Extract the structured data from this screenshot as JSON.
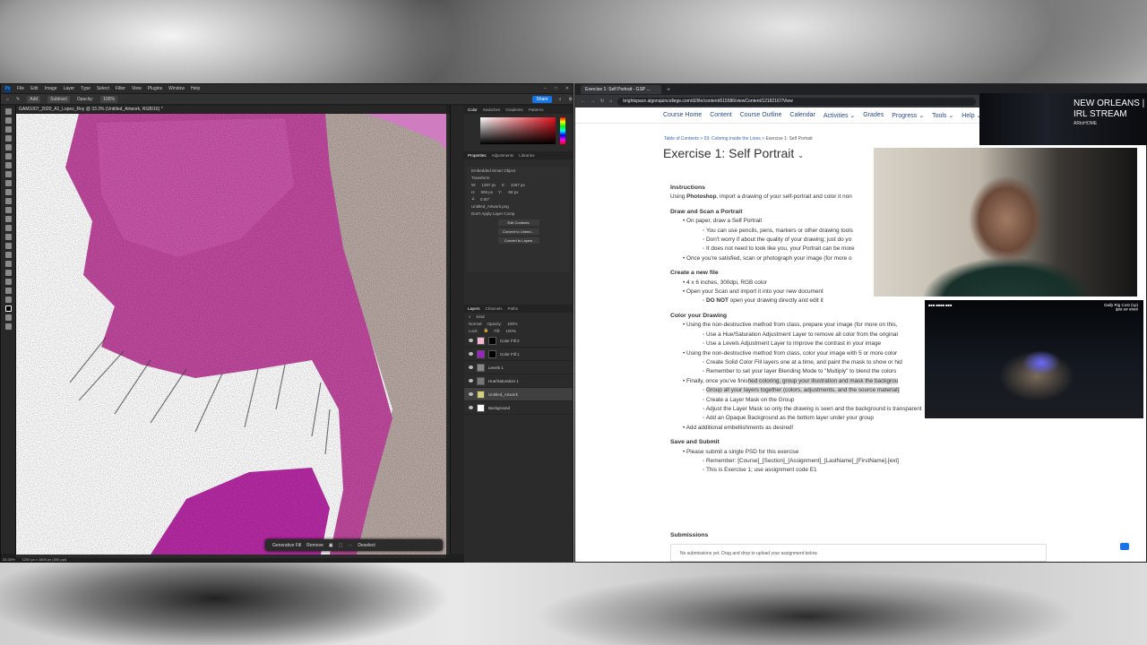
{
  "photoshop": {
    "menu": [
      "File",
      "Edit",
      "Image",
      "Layer",
      "Type",
      "Select",
      "Filter",
      "View",
      "Plugins",
      "Window",
      "Help"
    ],
    "options": {
      "add": "Add",
      "subtract": "Subtract",
      "opacity_label": "Opacity:",
      "opacity": "100%"
    },
    "share": "Share",
    "doc_tab": "GAM1007_2020_A1_Lopez_Roy @ 33.3% (Untitled_Artwork, RGB/16) *",
    "status": {
      "zoom": "33.33%",
      "size": "1200 px x 1800 px (300 ppi)"
    },
    "context_bar": {
      "generative": "Generative Fill",
      "remove": "Remove",
      "deselect": "Deselect"
    },
    "color_tabs": [
      "Color",
      "Swatches",
      "Gradients",
      "Patterns"
    ],
    "prop_tabs": [
      "Properties",
      "Adjustments",
      "Libraries"
    ],
    "properties": {
      "object_type": "Embedded Smart Object",
      "transform": "Transform",
      "w": "1287 px",
      "x": "1067 px",
      "h": "906 px",
      "y": "-58 px",
      "angle": "0.00°",
      "filename": "Untitled_Artwork.png",
      "layer_comps": "Don't Apply Layer Comp",
      "btn_edit": "Edit Contents",
      "btn_linked": "Convert to Linked...",
      "btn_layers": "Convert to Layers"
    },
    "layer_tabs": [
      "Layers",
      "Channels",
      "Paths"
    ],
    "layer_kind": "Kind",
    "blend": "Normal",
    "opacity_label": "Opacity:",
    "opacity": "100%",
    "lock": "Lock:",
    "fill_label": "Fill:",
    "fill": "100%",
    "layers": [
      {
        "name": "Color Fill 2",
        "thumb": "#f2b8cf",
        "mask": true,
        "selected": false
      },
      {
        "name": "Color Fill 1",
        "thumb": "#a020c8",
        "mask": true,
        "selected": false
      },
      {
        "name": "Levels 1",
        "thumb": "#888888",
        "mask": false,
        "selected": false
      },
      {
        "name": "Hue/Saturation 1",
        "thumb": "#777777",
        "mask": false,
        "selected": false
      },
      {
        "name": "Untitled_Artwork",
        "thumb": "#d6cf7a",
        "mask": false,
        "selected": true
      },
      {
        "name": "Background",
        "thumb": "#ffffff",
        "mask": false,
        "selected": false
      }
    ]
  },
  "browser": {
    "tab_title": "Exercise 1: Self Portrait - GSP ...",
    "url": "brightspace.algonquincollege.com/d2l/le/content/615586/viewContent/12182167/View",
    "nav": [
      "Course Home",
      "Content",
      "Course Outline",
      "Calendar",
      "Activities ⌄",
      "Grades",
      "Progress ⌄",
      "Tools ⌄",
      "Help ⌄"
    ],
    "breadcrumb": [
      "Table of Contents",
      "03: Coloring inside the Lines",
      "Exercise 1: Self Portrait"
    ],
    "title": "Exercise 1: Self Portrait",
    "instructions_heading": "Instructions",
    "instructions_pre": "Using ",
    "instructions_bold": "Photoshop",
    "instructions_post": ", import a drawing of your self-portrait and color it non",
    "sec1": "Draw and Scan a Portrait",
    "s1_1": "On paper, draw a Self Portrait",
    "s1_1a": "You can use pencils, pens, markers or other drawing tools",
    "s1_1b": "Don't worry if about the quality of your drawing; just do yo",
    "s1_1c": "It does not need to look like you, your Portrait can be more",
    "s1_2": "Once you're satisfied, scan or photograph your image (for more o",
    "sec2": "Create a new file",
    "s2_1": "4 x 6 inches, 300dpi, RGB color",
    "s2_2": "Open your Scan and import it into your new document",
    "s2_2a_bold": "DO NOT",
    "s2_2a": " open your drawing directly and edit it",
    "sec3": "Color your Drawing",
    "s3_1": "Using the non-destructive method from class, prepare your image (for more on this,",
    "s3_1a": "Use a Hue/Saturation Adjustment Layer to remove all color from the original",
    "s3_1b": "Use a Levels Adjustment Layer to improve the contrast in your image",
    "s3_2": "Using the non-destructive method from class, color your image with 5 or more color",
    "s3_2a": "Create Solid Color Fill layers one at a time, and paint the mask to show or hid",
    "s3_2b": "Remember to set your layer Blending Mode to \"Multiply\" to blend the colors",
    "s3_3_pre": "Finally, once you've finis",
    "s3_3_hl": "hed coloring, group your illustration and mask the backgrou",
    "s3_3a": "Group all your layers together (colors, adjustments, and the source material)",
    "s3_3b": "Create a Layer Mask on the Group",
    "s3_3c": "Adjust the Layer Mask so only the drawing is seen and the background is transparent",
    "s3_3d": "Add an Opaque Background as the bottom layer under your group",
    "s3_4": "Add additional embellishments as desired!",
    "sec4": "Save and Submit",
    "s4_1": "Please submit a single PSD for this exercise",
    "s4_1a": "Remember: [Course]_[Section]_[Assignment]_[LastName]_[FirstName].[ext]",
    "s4_1b": "This is Exercise 1; use assignment code E1",
    "submissions": "Submissions",
    "dropzone": "No submissions yet. Drag and drop to upload your assignment below."
  },
  "overlays": {
    "stream_title": "NEW ORLEANS | IRL STREAM",
    "stream_sub": "ARtoHOME",
    "street_right": "Daily Rig Cost (1p)",
    "street_right2": "$##.## ####",
    "street_left": "■■■ ■■■■ ■■■"
  }
}
